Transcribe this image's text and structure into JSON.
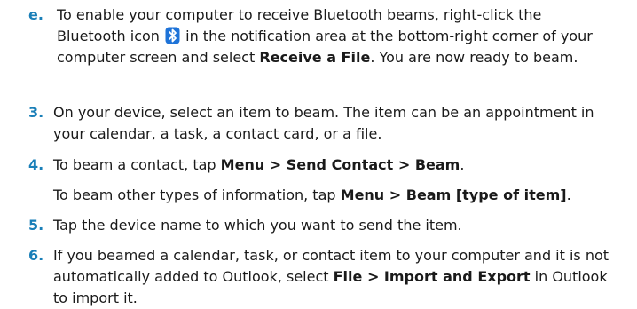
{
  "accent_color": "#1a7fb8",
  "bluetooth_icon_color": "#1e73d8",
  "step_e": {
    "marker": "e.",
    "t1": "To enable your computer to receive Bluetooth beams, right-click the Bluetooth icon",
    "t2": "in the notification area at the bottom-right corner of your computer screen and select",
    "b1": "Receive a File",
    "t3": ". You are now ready to beam."
  },
  "step3": {
    "marker": "3.",
    "t1": "On your device, select an item to beam. The item can be an appointment in your calendar, a task, a contact card, or a file."
  },
  "step4": {
    "marker": "4.",
    "t1": "To beam a contact, tap",
    "b1": "Menu > Send Contact > Beam",
    "t2": ".",
    "t3": "To beam other types of information, tap",
    "b2": "Menu > Beam [type of item]",
    "t4": "."
  },
  "step5": {
    "marker": "5.",
    "t1": "Tap the device name to which you want to send the item."
  },
  "step6": {
    "marker": "6.",
    "t1": "If you beamed a calendar, task, or contact item to your computer and it is not automatically added to Outlook, select",
    "b1": "File > Import and Export",
    "t2": "in Outlook to import it."
  }
}
